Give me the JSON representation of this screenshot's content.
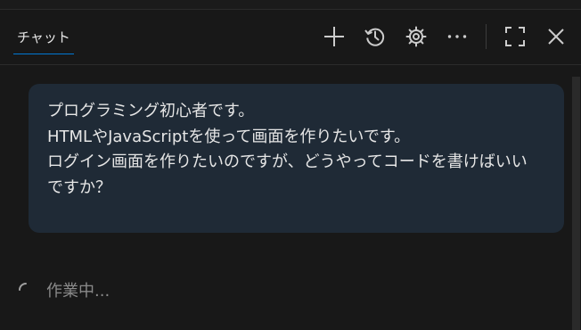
{
  "header": {
    "tab_label": "チャット"
  },
  "toolbar": {
    "buttons": [
      {
        "icon": "plus-icon",
        "title": "New Chat"
      },
      {
        "icon": "history-icon",
        "title": "History"
      },
      {
        "icon": "gear-icon",
        "title": "Settings"
      },
      {
        "icon": "more-icon",
        "title": "More"
      },
      {
        "icon": "maximize-icon",
        "title": "Maximize"
      },
      {
        "icon": "close-icon",
        "title": "Close"
      }
    ]
  },
  "message": {
    "lines": [
      "プログラミング初心者です。",
      "HTMLやJavaScriptを使って画面を作りたいです。",
      "ログイン画面を作りたいのですが、どうやってコードを書けばいい",
      "ですか？"
    ]
  },
  "status": {
    "text": "作業中..."
  },
  "colors": {
    "background": "#181818",
    "bubble": "#1f2a36",
    "accent": "#0078d4",
    "icon": "#cccccc",
    "muted_text": "#8a8a8a"
  }
}
